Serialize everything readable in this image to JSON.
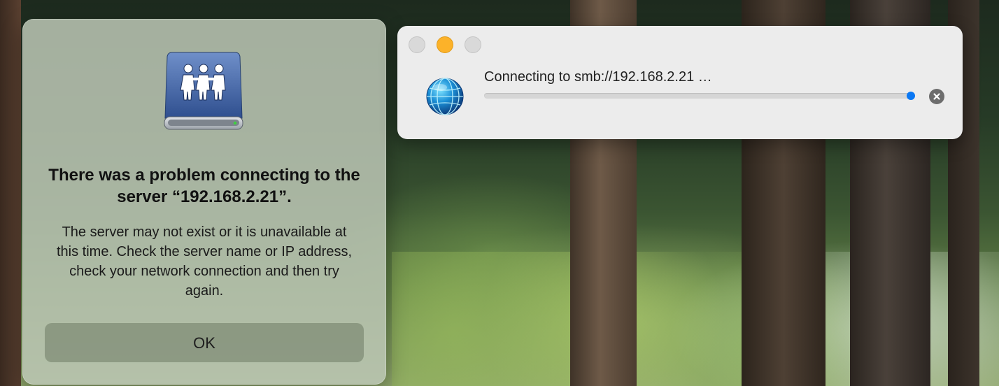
{
  "alert": {
    "title": "There was a problem connecting to the server “192.168.2.21”.",
    "message": "The server may not exist or it is unavailable at this time. Check the server name or IP address, check your network connection and then try again.",
    "ok_label": "OK",
    "icon": "shared-server-drive-icon"
  },
  "progress_window": {
    "status_text": "Connecting to smb://192.168.2.21 …",
    "progress_fraction": 0.99,
    "icon": "network-globe-icon",
    "cancel_icon": "stop-x-icon",
    "window_buttons": [
      "close",
      "minimize",
      "zoom"
    ]
  },
  "colors": {
    "accent": "#0a78f4",
    "minimize": "#fcb229"
  }
}
